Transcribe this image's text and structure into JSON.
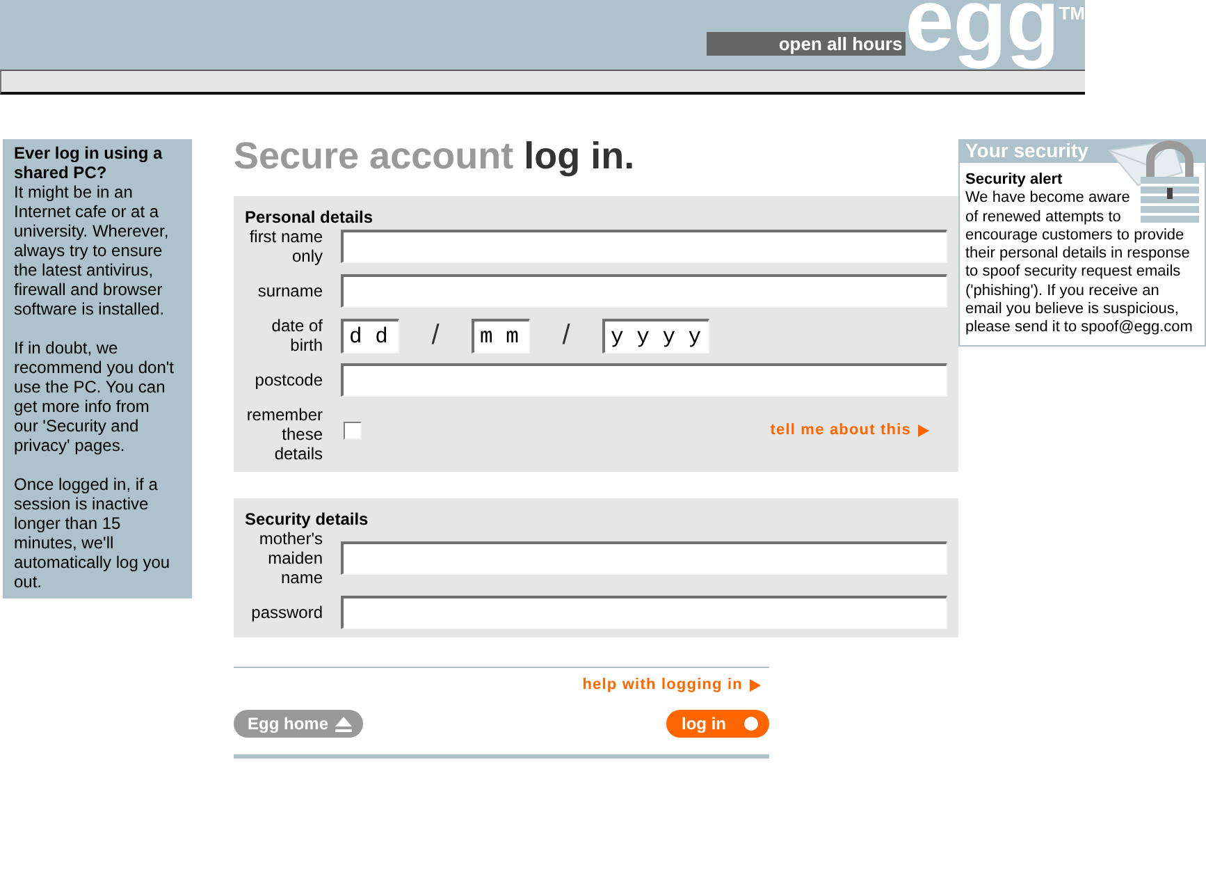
{
  "header": {
    "tagline": "open all hours",
    "logo": "egg",
    "trademark": "TM"
  },
  "sidebar": {
    "heading": "Ever log in using a shared PC?",
    "paragraphs": [
      "It might be in an Internet cafe or at a university. Wherever, always try to ensure the latest antivirus, firewall and browser software is installed.",
      "If in doubt, we recommend you don't use the PC. You can get more info from our 'Security and privacy' pages.",
      "Once logged in, if a session is inactive longer than 15 minutes, we'll automatically log you out."
    ]
  },
  "title": {
    "muted_part": "Secure account",
    "strong_part": "log in."
  },
  "personal_details": {
    "heading": "Personal details",
    "fields": [
      {
        "kind": "text",
        "label": "first name only"
      },
      {
        "kind": "text",
        "label": "surname"
      },
      {
        "kind": "date",
        "label": "date of birth",
        "parts": [
          {
            "placeholder": "d d"
          },
          {
            "placeholder": "m m"
          },
          {
            "placeholder": "y y y y"
          }
        ],
        "separators": [
          "/",
          "/"
        ]
      },
      {
        "kind": "text",
        "label": "postcode"
      },
      {
        "kind": "checkbox",
        "label": "remember these details",
        "checked": false,
        "link": "tell me about this"
      }
    ]
  },
  "security_details": {
    "heading": "Security details",
    "fields": [
      {
        "kind": "text",
        "label": "mother's maiden name"
      },
      {
        "kind": "text",
        "label": "password"
      }
    ]
  },
  "help_link": "help with logging in",
  "buttons": [
    {
      "kind": "secondary",
      "label": "Egg home"
    },
    {
      "kind": "primary",
      "label": "log in"
    }
  ],
  "security_box": {
    "heading": "Your security",
    "alert_title": "Security alert",
    "alert_text": "We have become aware of renewed attempts to encourage customers to provide their personal details in response to spoof security request emails ('phishing'). If you receive an email you believe is suspicious, please send it to spoof@egg.com"
  }
}
